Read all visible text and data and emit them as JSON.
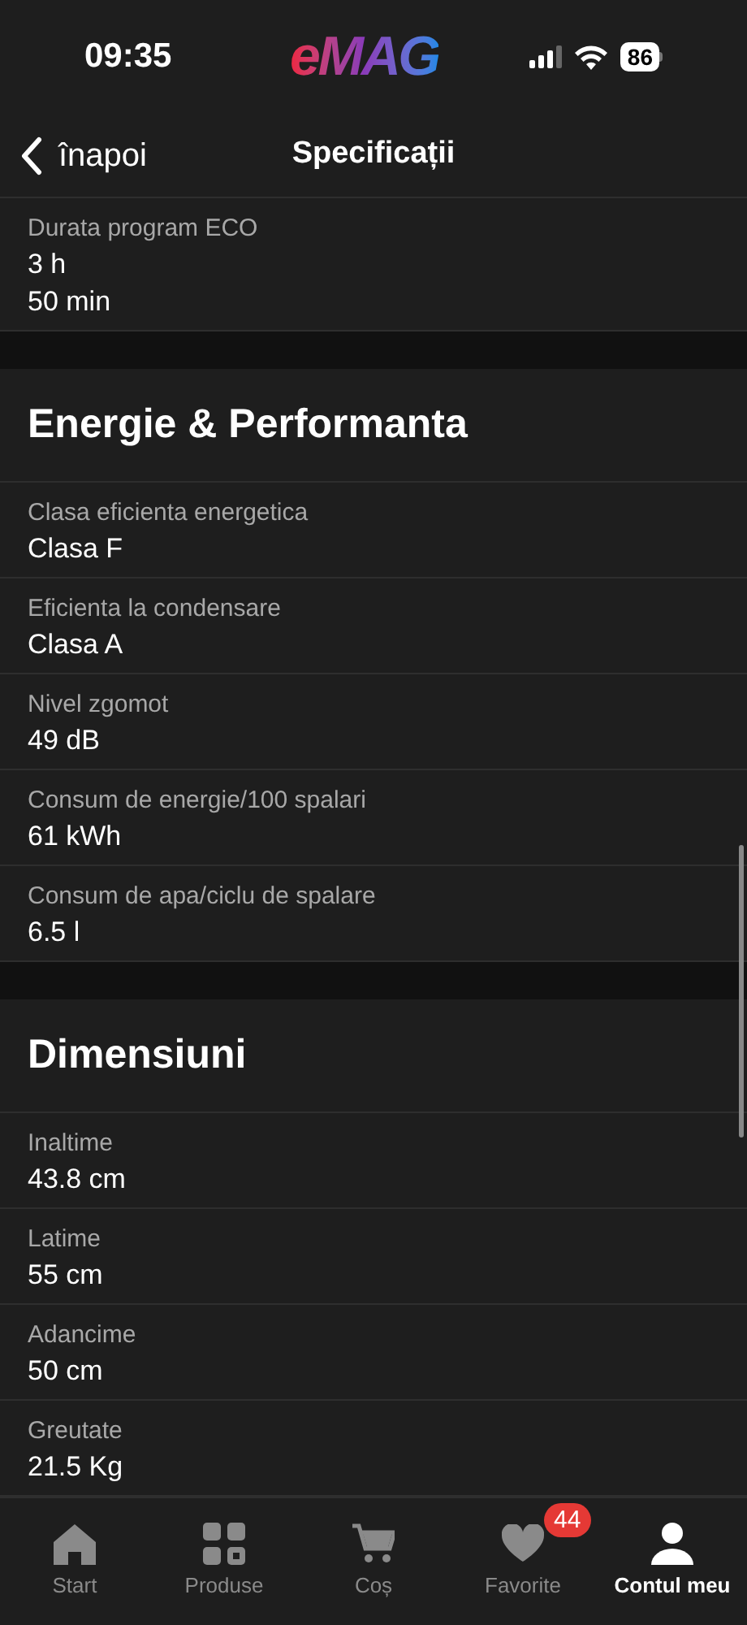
{
  "status_bar": {
    "time": "09:35",
    "logo": "eMAG",
    "battery": "86"
  },
  "nav": {
    "back": "înapoi",
    "title": "Specificații"
  },
  "sections": [
    {
      "rows": [
        {
          "label": "Durata program ECO",
          "lines": [
            "3 h",
            "50 min"
          ]
        }
      ]
    },
    {
      "title": "Energie & Performanta",
      "rows": [
        {
          "label": "Clasa eficienta energetica",
          "lines": [
            "Clasa F"
          ]
        },
        {
          "label": "Eficienta la condensare",
          "lines": [
            "Clasa A"
          ]
        },
        {
          "label": "Nivel zgomot",
          "lines": [
            "49 dB"
          ]
        },
        {
          "label": "Consum de energie/100 spalari",
          "lines": [
            "61 kWh"
          ]
        },
        {
          "label": "Consum de apa/ciclu de spalare",
          "lines": [
            "6.5 l"
          ]
        }
      ]
    },
    {
      "title": "Dimensiuni",
      "rows": [
        {
          "label": "Inaltime",
          "lines": [
            "43.8 cm"
          ]
        },
        {
          "label": "Latime",
          "lines": [
            "55 cm"
          ]
        },
        {
          "label": "Adancime",
          "lines": [
            "50 cm"
          ]
        },
        {
          "label": "Greutate",
          "lines": [
            "21.5 Kg"
          ]
        }
      ]
    }
  ],
  "tab_bar": [
    {
      "kind": "home",
      "label": "Start",
      "selected": false
    },
    {
      "kind": "grid",
      "label": "Produse",
      "selected": false
    },
    {
      "kind": "cart",
      "label": "Coș",
      "selected": false
    },
    {
      "kind": "heart",
      "label": "Favorite",
      "selected": false,
      "badge": "44"
    },
    {
      "kind": "person",
      "label": "Contul meu",
      "selected": true
    }
  ]
}
